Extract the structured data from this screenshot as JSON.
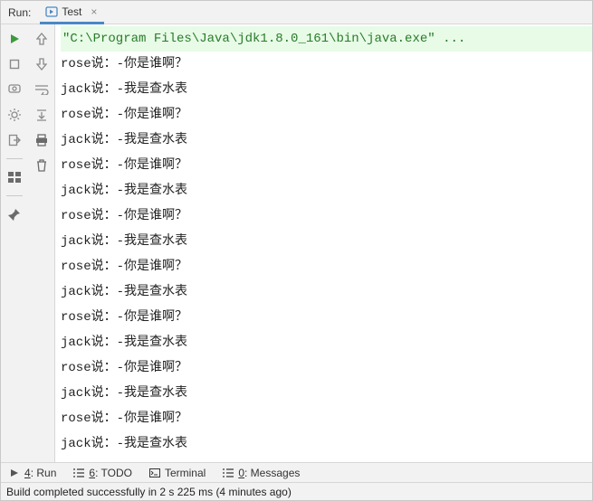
{
  "header": {
    "run_label": "Run:",
    "tab": {
      "name": "Test",
      "close": "×"
    }
  },
  "console": {
    "command": "\"C:\\Program Files\\Java\\jdk1.8.0_161\\bin\\java.exe\" ...",
    "lines": [
      "rose说：-你是谁啊？",
      "jack说：-我是查水表",
      "rose说：-你是谁啊？",
      "jack说：-我是查水表",
      "rose说：-你是谁啊？",
      "jack说：-我是查水表",
      "rose说：-你是谁啊？",
      "jack说：-我是查水表",
      "rose说：-你是谁啊？",
      "jack说：-我是查水表",
      "rose说：-你是谁啊？",
      "jack说：-我是查水表",
      "rose说：-你是谁啊？",
      "jack说：-我是查水表",
      "rose说：-你是谁啊？",
      "jack说：-我是查水表"
    ]
  },
  "bottom": {
    "run": {
      "prefix": "4",
      "label": ": Run"
    },
    "todo": {
      "prefix": "6",
      "label": ": TODO"
    },
    "terminal": "Terminal",
    "messages": {
      "prefix": "0",
      "label": ": Messages"
    }
  },
  "status": "Build completed successfully in 2 s 225 ms (4 minutes ago)"
}
